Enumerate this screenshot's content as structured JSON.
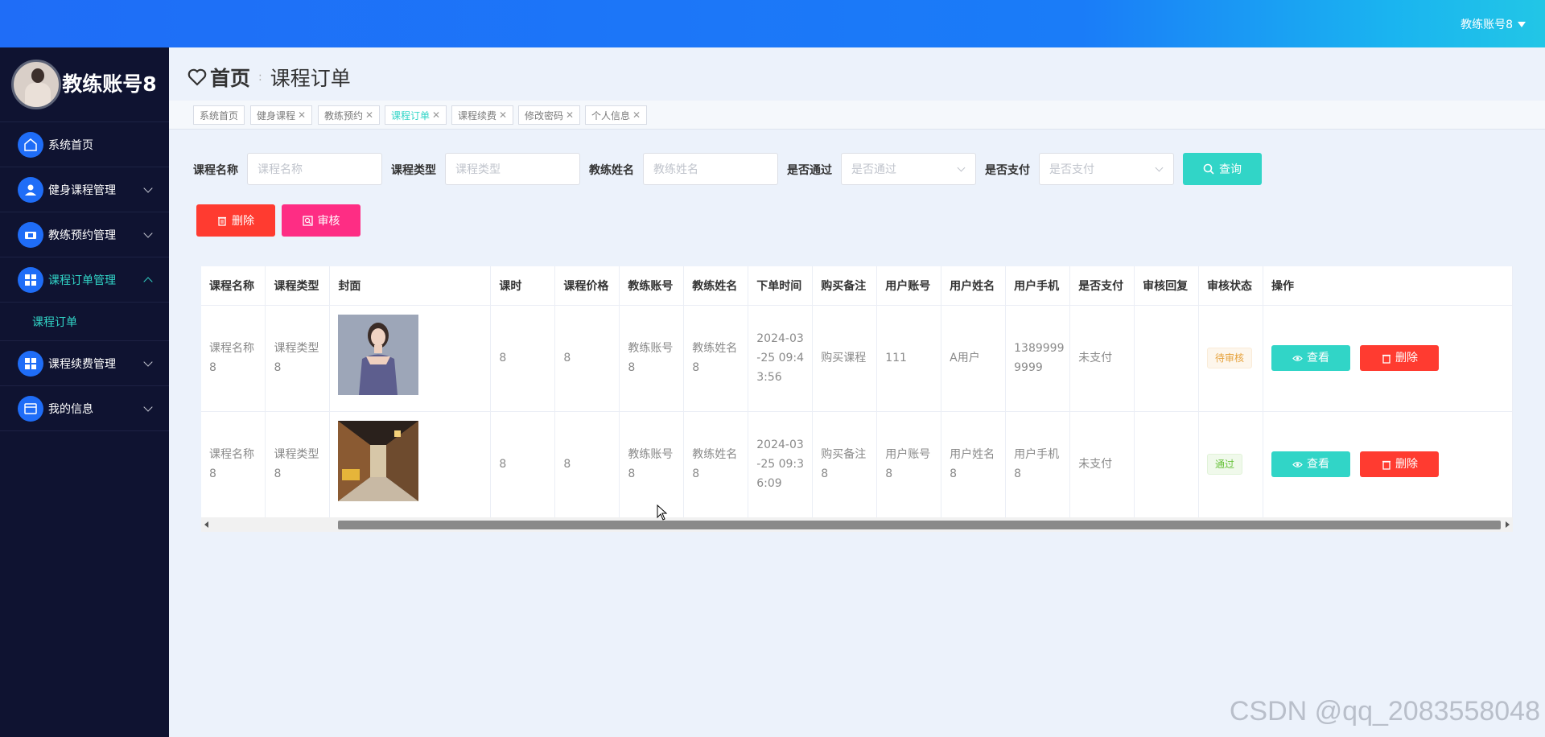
{
  "topbar": {
    "user": "教练账号8"
  },
  "sidebar": {
    "profile_name": "教练账号8",
    "items": [
      {
        "label": "系统首页",
        "icon": "home-icon"
      },
      {
        "label": "健身课程管理",
        "icon": "user-icon"
      },
      {
        "label": "教练预约管理",
        "icon": "ticket-icon"
      },
      {
        "label": "课程订单管理",
        "icon": "grid-icon",
        "expanded": true,
        "sub": [
          "课程订单"
        ]
      },
      {
        "label": "课程续费管理",
        "icon": "grid-icon"
      },
      {
        "label": "我的信息",
        "icon": "card-icon"
      }
    ]
  },
  "breadcrumb": {
    "home": "首页",
    "current": "课程订单"
  },
  "tags": [
    "系统首页",
    "健身课程",
    "教练预约",
    "课程订单",
    "课程续费",
    "修改密码",
    "个人信息"
  ],
  "search": {
    "course_name": {
      "label": "课程名称",
      "placeholder": "课程名称"
    },
    "course_type": {
      "label": "课程类型",
      "placeholder": "课程类型"
    },
    "coach_name": {
      "label": "教练姓名",
      "placeholder": "教练姓名"
    },
    "passed": {
      "label": "是否通过",
      "placeholder": "是否通过"
    },
    "paid": {
      "label": "是否支付",
      "placeholder": "是否支付"
    },
    "query_label": "查询"
  },
  "actions": {
    "delete_label": "删除",
    "audit_label": "审核"
  },
  "table": {
    "columns": [
      "课程名称",
      "课程类型",
      "封面",
      "课时",
      "课程价格",
      "教练账号",
      "教练姓名",
      "下单时间",
      "购买备注",
      "用户账号",
      "用户姓名",
      "用户手机",
      "是否支付",
      "审核回复",
      "审核状态",
      "操作"
    ],
    "rows": [
      {
        "course_name": "课程名称8",
        "course_type": "课程类型8",
        "hours": "8",
        "price": "8",
        "coach_account": "教练账号8",
        "coach_name": "教练姓名8",
        "order_time": "2024-03-25 09:43:56",
        "note": "购买课程",
        "user_account": "111",
        "user_name": "A用户",
        "phone": "13899999999",
        "paid": "未支付",
        "reply": "",
        "status": "待审核"
      },
      {
        "course_name": "课程名称8",
        "course_type": "课程类型8",
        "hours": "8",
        "price": "8",
        "coach_account": "教练账号8",
        "coach_name": "教练姓名8",
        "order_time": "2024-03-25 09:36:09",
        "note": "购买备注8",
        "user_account": "用户账号8",
        "user_name": "用户姓名8",
        "phone": "用户手机8",
        "paid": "未支付",
        "reply": "",
        "status": "通过"
      }
    ],
    "view_label": "查看",
    "delete_label": "删除"
  },
  "watermark": "CSDN @qq_2083558048",
  "colors": {
    "primary": "#1f6df7",
    "teal": "#31d5c7",
    "danger": "#ff3b30",
    "pink": "#fe2d84",
    "sidebar": "#0f1331"
  }
}
